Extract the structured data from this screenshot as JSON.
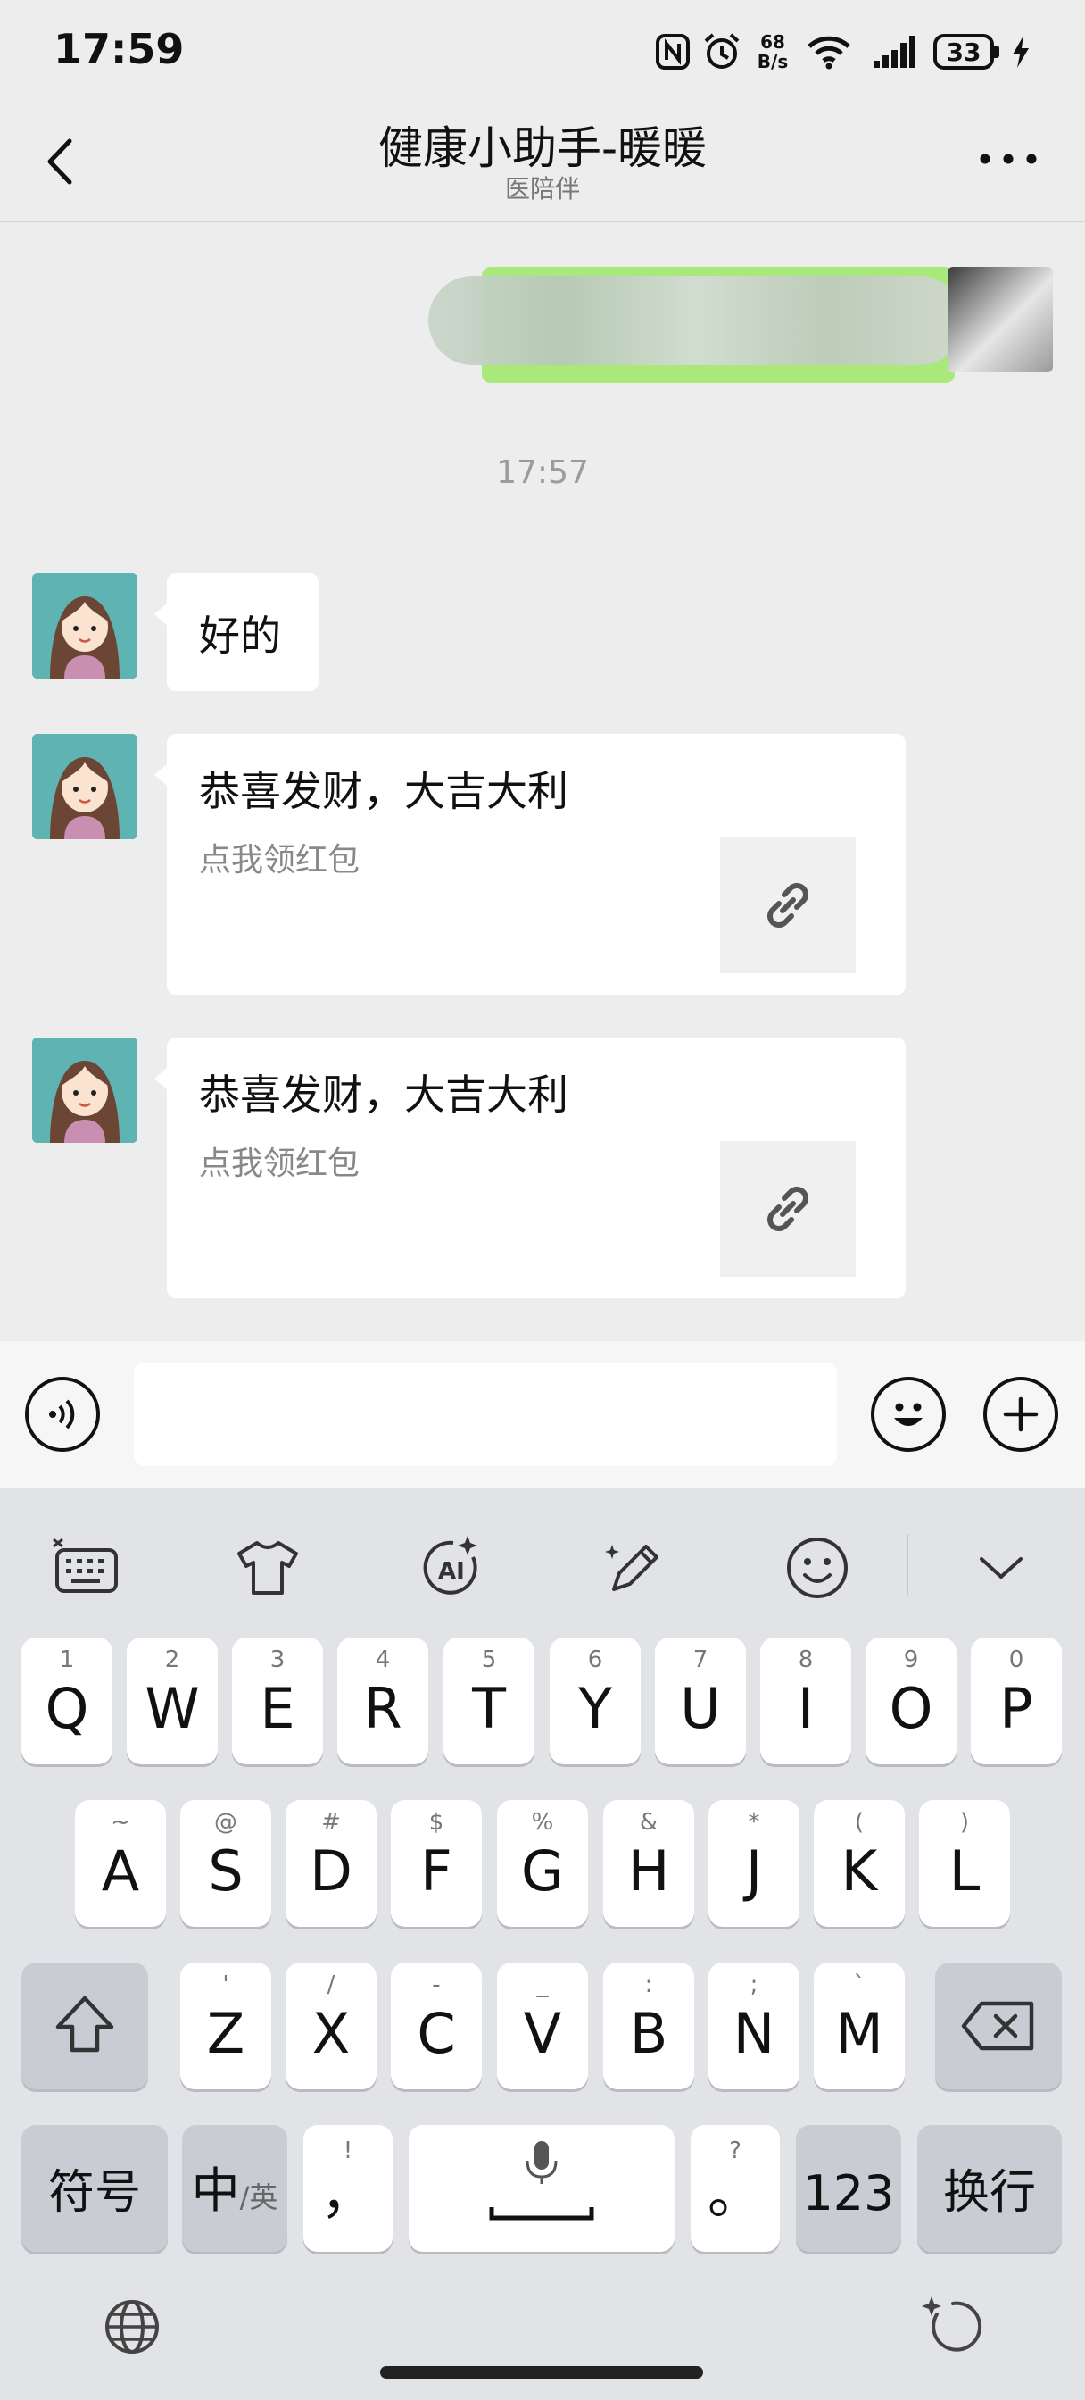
{
  "status_bar": {
    "time": "17:59",
    "net_speed_top": "68",
    "net_speed_bottom": "B/s",
    "battery": "33"
  },
  "header": {
    "title": "健康小助手-暖暖",
    "subtitle": "医陪伴"
  },
  "chat": {
    "timestamp": "17:57",
    "messages": [
      {
        "text": "好的"
      },
      {
        "title": "恭喜发财，大吉大利",
        "desc": "点我领红包"
      },
      {
        "title": "恭喜发财，大吉大利",
        "desc": "点我领红包"
      }
    ]
  },
  "input": {
    "value": ""
  },
  "keyboard": {
    "row1": [
      {
        "k": "Q",
        "h": "1"
      },
      {
        "k": "W",
        "h": "2"
      },
      {
        "k": "E",
        "h": "3"
      },
      {
        "k": "R",
        "h": "4"
      },
      {
        "k": "T",
        "h": "5"
      },
      {
        "k": "Y",
        "h": "6"
      },
      {
        "k": "U",
        "h": "7"
      },
      {
        "k": "I",
        "h": "8"
      },
      {
        "k": "O",
        "h": "9"
      },
      {
        "k": "P",
        "h": "0"
      }
    ],
    "row2": [
      {
        "k": "A",
        "h": "~"
      },
      {
        "k": "S",
        "h": "@"
      },
      {
        "k": "D",
        "h": "#"
      },
      {
        "k": "F",
        "h": "$"
      },
      {
        "k": "G",
        "h": "%"
      },
      {
        "k": "H",
        "h": "&"
      },
      {
        "k": "J",
        "h": "*"
      },
      {
        "k": "K",
        "h": "("
      },
      {
        "k": "L",
        "h": ")"
      }
    ],
    "row3": [
      {
        "k": "Z",
        "h": "'"
      },
      {
        "k": "X",
        "h": "/"
      },
      {
        "k": "C",
        "h": "-"
      },
      {
        "k": "V",
        "h": "_"
      },
      {
        "k": "B",
        "h": ":"
      },
      {
        "k": "N",
        "h": ";"
      },
      {
        "k": "M",
        "h": "`"
      }
    ],
    "symbols": "符号",
    "lang_main": "中",
    "lang_sub": "/英",
    "comma": "，",
    "comma_hint": "!",
    "period": "。",
    "period_hint": "?",
    "numbers": "123",
    "enter": "换行"
  }
}
